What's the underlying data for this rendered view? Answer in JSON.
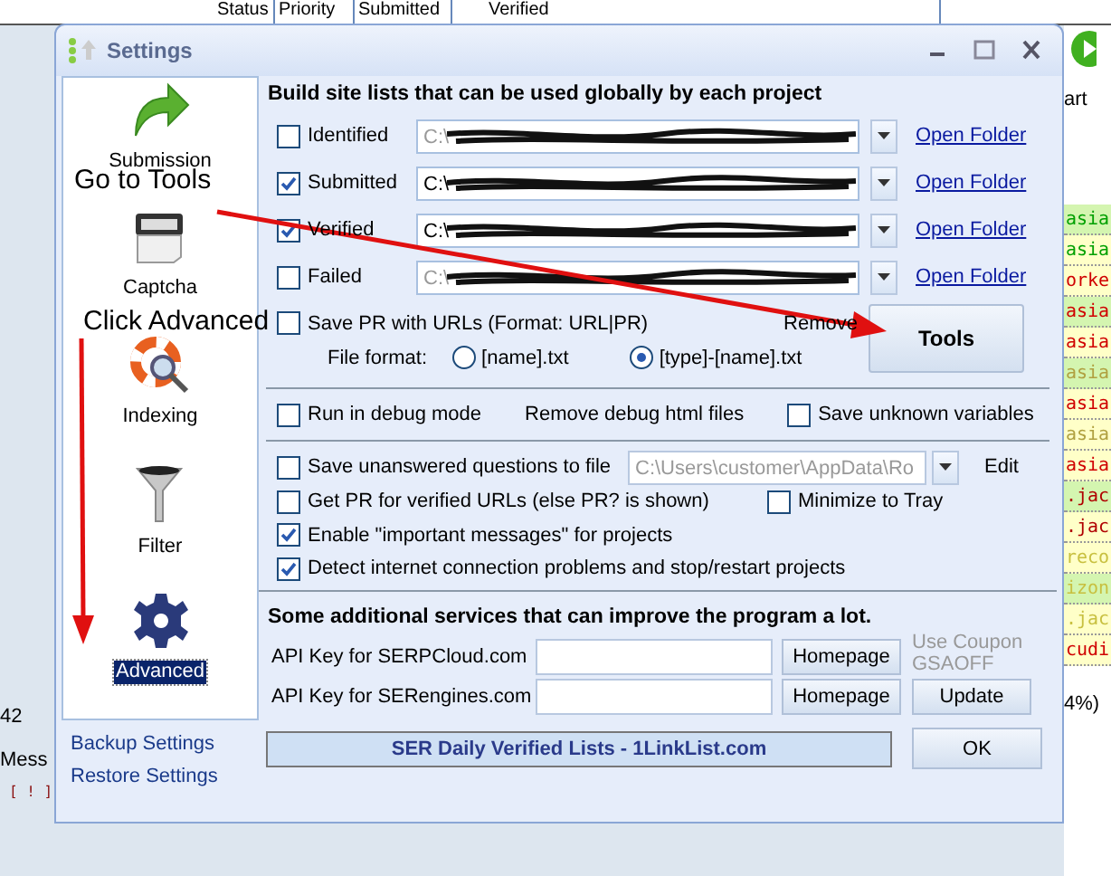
{
  "background_app": {
    "columns": [
      "Status",
      "Priority",
      "Submitted",
      "Verified"
    ],
    "start_label": "art",
    "count": "42",
    "message_header": "Mess",
    "message_flag": "[ ! ]",
    "progress": "4%)",
    "rows": [
      {
        "text": "asia",
        "color": "#00a000"
      },
      {
        "text": "asia",
        "color": "#00a000"
      },
      {
        "text": "orke",
        "color": "#d00000"
      },
      {
        "text": "asia",
        "color": "#d00000"
      },
      {
        "text": "asia",
        "color": "#d00000"
      },
      {
        "text": "asia",
        "color": "#b0a040"
      },
      {
        "text": "asia",
        "color": "#d00000"
      },
      {
        "text": "asia",
        "color": "#b0a040"
      },
      {
        "text": "asia",
        "color": "#d00000"
      },
      {
        "text": ".jac",
        "color": "#b00000"
      },
      {
        "text": ".jac",
        "color": "#b00000"
      },
      {
        "text": "reco",
        "color": "#c8c040"
      },
      {
        "text": "izon",
        "color": "#c8c040"
      },
      {
        "text": ".jac",
        "color": "#c8c040"
      },
      {
        "text": "cudi",
        "color": "#d00000"
      }
    ]
  },
  "window": {
    "title": "Settings"
  },
  "sidebar": {
    "items": [
      {
        "label": "Submission",
        "kind": "arrow",
        "selected": false
      },
      {
        "label": "Captcha",
        "kind": "device",
        "selected": false
      },
      {
        "label": "Indexing",
        "kind": "lifebuoy",
        "selected": false
      },
      {
        "label": "Filter",
        "kind": "funnel",
        "selected": false
      },
      {
        "label": "Advanced",
        "kind": "gear",
        "selected": true
      }
    ],
    "links": [
      "Backup Settings",
      "Restore Settings"
    ]
  },
  "site_lists": {
    "heading": "Build site lists that can be used globally by each project",
    "lists": [
      {
        "label": "Identified",
        "checked": false,
        "path": "C:\\",
        "disabled": true,
        "link": "Open Folder"
      },
      {
        "label": "Submitted",
        "checked": true,
        "path": "C:\\",
        "disabled": false,
        "link": "Open Folder"
      },
      {
        "label": "Verified",
        "checked": true,
        "path": "C:\\",
        "disabled": false,
        "link": "Open Folder"
      },
      {
        "label": "Failed",
        "checked": false,
        "path": "C:\\",
        "disabled": true,
        "link": "Open Folder"
      }
    ],
    "save_pr": {
      "label": "Save PR with URLs (Format: URL|PR)",
      "checked": false
    },
    "remove_label": "Remove",
    "tools_button": "Tools",
    "file_format": {
      "label": "File format:",
      "options": [
        {
          "label": "[name].txt",
          "selected": false
        },
        {
          "label": "[type]-[name].txt",
          "selected": true
        }
      ]
    }
  },
  "debug": {
    "run_debug": {
      "label": "Run in debug mode",
      "checked": false
    },
    "remove_html": "Remove debug html files",
    "save_unknown": {
      "label": "Save unknown variables",
      "checked": false
    }
  },
  "options": {
    "save_unanswered": {
      "label": "Save unanswered questions to file",
      "checked": false,
      "path": "C:\\Users\\customer\\AppData\\Ro",
      "edit": "Edit"
    },
    "get_pr": {
      "label": "Get PR for verified URLs (else PR? is shown)",
      "checked": false
    },
    "minimize": {
      "label": "Minimize to Tray",
      "checked": false
    },
    "enable_messages": {
      "label": "Enable \"important messages\" for projects",
      "checked": true
    },
    "detect": {
      "label": "Detect internet connection problems and stop/restart projects",
      "checked": true
    }
  },
  "services": {
    "heading": "Some additional services that can improve the program a lot.",
    "rows": [
      {
        "label": "API Key for SERPCloud.com",
        "button": "Homepage"
      },
      {
        "label": "API Key for SERengines.com",
        "button": "Homepage"
      }
    ],
    "coupon": "Use Coupon GSAOFF",
    "update": "Update"
  },
  "footer": {
    "banner": "SER Daily Verified Lists - 1LinkList.com",
    "ok": "OK"
  },
  "annotations": [
    "Go to Tools",
    "Click Advanced"
  ]
}
